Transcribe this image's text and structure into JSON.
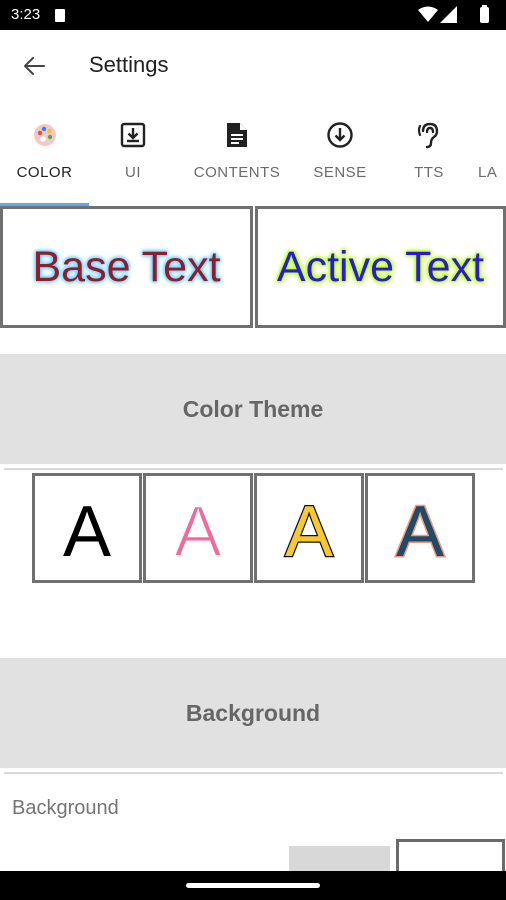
{
  "status_bar": {
    "time": "3:23"
  },
  "app_bar": {
    "title": "Settings"
  },
  "tabs": [
    {
      "label": "COLOR",
      "icon": "palette-icon",
      "active": true
    },
    {
      "label": "UI",
      "icon": "download-box-icon"
    },
    {
      "label": "CONTENTS",
      "icon": "document-icon"
    },
    {
      "label": "SENSE",
      "icon": "arrow-down-circle-icon"
    },
    {
      "label": "TTS",
      "icon": "hearing-icon"
    },
    {
      "label": "LA",
      "icon": ""
    }
  ],
  "preview": {
    "base_text": "Base Text",
    "active_text": "Active Text",
    "base_color": "#8a1f2e",
    "base_outline": "#7dd3ff",
    "active_color": "#2a1ad3",
    "active_outline": "#b8ff1a"
  },
  "sections": {
    "color_theme": "Color Theme",
    "background": "Background"
  },
  "color_themes": [
    {
      "letter": "A",
      "fill": "#000000",
      "stroke": "none"
    },
    {
      "letter": "A",
      "fill": "#f06aa0",
      "stroke": "#ffffff"
    },
    {
      "letter": "A",
      "fill": "#f6c832",
      "stroke": "#111111"
    },
    {
      "letter": "A",
      "fill": "#1f4a68",
      "stroke": "#f29a7a"
    }
  ],
  "background": {
    "label": "Background"
  },
  "colors": {
    "accent": "#5fa9e8",
    "section_bg": "#e1e1e1",
    "border": "#707070"
  }
}
